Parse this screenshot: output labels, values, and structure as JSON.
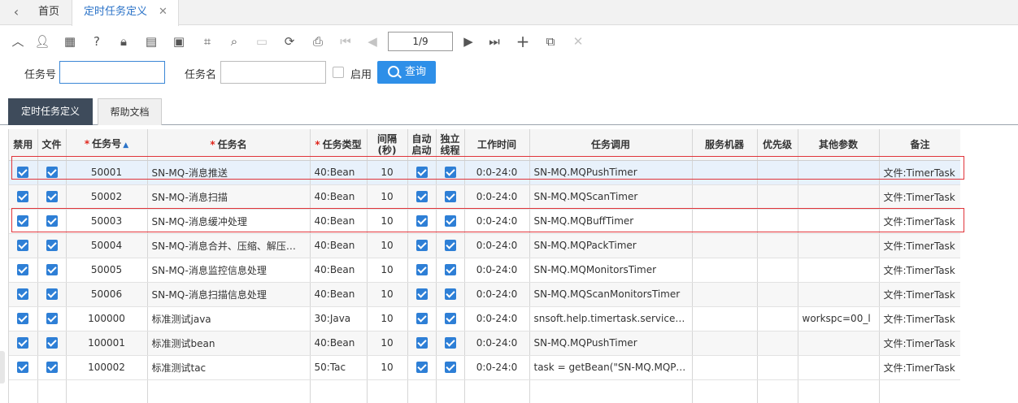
{
  "tabs": {
    "home": "首页",
    "active": "定时任务定义"
  },
  "toolbar": {
    "pager_text": "1/9",
    "icons": [
      "collapse-up-icon",
      "user-icon",
      "calculator-icon",
      "help-icon",
      "lock-icon",
      "document-icon",
      "clipboard-icon",
      "crop-icon",
      "search-icon",
      "save-icon",
      "refresh-icon",
      "print-icon",
      "first-page-icon",
      "prev-page-icon",
      "next-page-icon",
      "last-page-icon",
      "add-icon",
      "copy-icon",
      "delete-icon"
    ]
  },
  "search": {
    "task_no_label": "任务号",
    "task_no_value": "",
    "task_name_label": "任务名",
    "task_name_value": "",
    "enabled_label": "启用",
    "query_button": "查询"
  },
  "subtabs": [
    "定时任务定义",
    "帮助文档"
  ],
  "grid": {
    "columns": [
      "禁用",
      "文件",
      "任务号",
      "任务名",
      "任务类型",
      "间隔(秒)",
      "自动启动",
      "独立线程",
      "工作时间",
      "任务调用",
      "服务机器",
      "优先级",
      "其他参数",
      "备注"
    ],
    "rows": [
      {
        "disabled": true,
        "file": true,
        "task_no": "50001",
        "task_name": "SN-MQ-消息推送",
        "task_type": "40:Bean",
        "interval": "10",
        "auto_start": true,
        "independent": true,
        "work_time": "0:0-24:0",
        "invoke": "SN-MQ.MQPushTimer",
        "server": "",
        "priority": "",
        "params": "",
        "remark": "文件:TimerTask"
      },
      {
        "disabled": true,
        "file": true,
        "task_no": "50002",
        "task_name": "SN-MQ-消息扫描",
        "task_type": "40:Bean",
        "interval": "10",
        "auto_start": true,
        "independent": true,
        "work_time": "0:0-24:0",
        "invoke": "SN-MQ.MQScanTimer",
        "server": "",
        "priority": "",
        "params": "",
        "remark": "文件:TimerTask"
      },
      {
        "disabled": true,
        "file": true,
        "task_no": "50003",
        "task_name": "SN-MQ-消息缓冲处理",
        "task_type": "40:Bean",
        "interval": "10",
        "auto_start": true,
        "independent": true,
        "work_time": "0:0-24:0",
        "invoke": "SN-MQ.MQBuffTimer",
        "server": "",
        "priority": "",
        "params": "",
        "remark": "文件:TimerTask"
      },
      {
        "disabled": true,
        "file": true,
        "task_no": "50004",
        "task_name": "SN-MQ-消息合并、压缩、解压处理",
        "task_type": "40:Bean",
        "interval": "10",
        "auto_start": true,
        "independent": true,
        "work_time": "0:0-24:0",
        "invoke": "SN-MQ.MQPackTimer",
        "server": "",
        "priority": "",
        "params": "",
        "remark": "文件:TimerTask"
      },
      {
        "disabled": true,
        "file": true,
        "task_no": "50005",
        "task_name": "SN-MQ-消息监控信息处理",
        "task_type": "40:Bean",
        "interval": "10",
        "auto_start": true,
        "independent": true,
        "work_time": "0:0-24:0",
        "invoke": "SN-MQ.MQMonitorsTimer",
        "server": "",
        "priority": "",
        "params": "",
        "remark": "文件:TimerTask"
      },
      {
        "disabled": true,
        "file": true,
        "task_no": "50006",
        "task_name": "SN-MQ-消息扫描信息处理",
        "task_type": "40:Bean",
        "interval": "10",
        "auto_start": true,
        "independent": true,
        "work_time": "0:0-24:0",
        "invoke": "SN-MQ.MQScanMonitorsTimer",
        "server": "",
        "priority": "",
        "params": "",
        "remark": "文件:TimerTask"
      },
      {
        "disabled": true,
        "file": true,
        "task_no": "100000",
        "task_name": "标准测试java",
        "task_type": "30:Java",
        "interval": "10",
        "auto_start": true,
        "independent": true,
        "work_time": "0:0-24:0",
        "invoke": "snsoft.help.timertask.service.impl.",
        "server": "",
        "priority": "",
        "params": "workspc=00_l",
        "remark": "文件:TimerTask"
      },
      {
        "disabled": true,
        "file": true,
        "task_no": "100001",
        "task_name": "标准测试bean",
        "task_type": "40:Bean",
        "interval": "10",
        "auto_start": true,
        "independent": true,
        "work_time": "0:0-24:0",
        "invoke": "SN-MQ.MQPushTimer",
        "server": "",
        "priority": "",
        "params": "",
        "remark": "文件:TimerTask"
      },
      {
        "disabled": true,
        "file": true,
        "task_no": "100002",
        "task_name": "标准测试tac",
        "task_type": "50:Tac",
        "interval": "10",
        "auto_start": true,
        "independent": true,
        "work_time": "0:0-24:0",
        "invoke": "task = getBean(\"SN-MQ.MQPushTimer\")",
        "server": "",
        "priority": "",
        "params": "",
        "remark": "文件:TimerTask"
      }
    ]
  }
}
